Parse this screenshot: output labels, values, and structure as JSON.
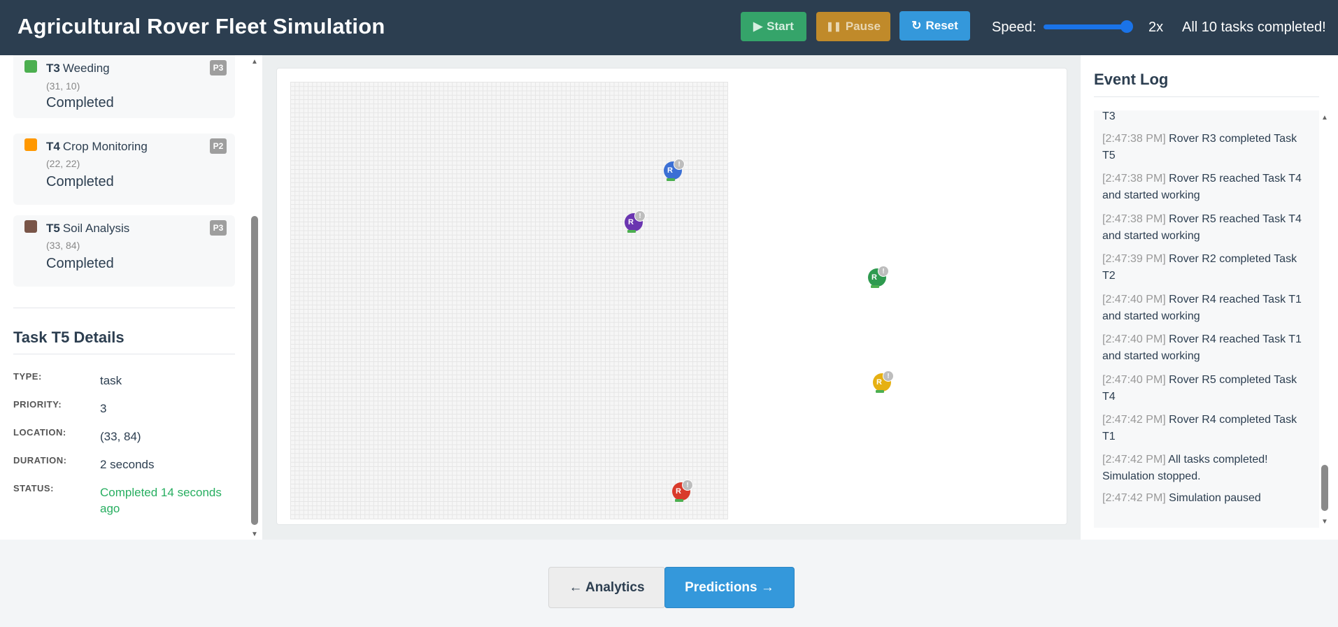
{
  "header": {
    "title": "Agricultural Rover Fleet Simulation",
    "start_label": "Start",
    "pause_label": "Pause",
    "reset_label": "Reset",
    "speed_label": "Speed:",
    "speed_value": "2x",
    "speed_slider_level": 1.0,
    "status": "All 10 tasks completed!"
  },
  "tasks": [
    {
      "id": "T3",
      "name": "Weeding",
      "coords": "(31, 10)",
      "status": "Completed",
      "priority": "P3",
      "color": "#4caf50"
    },
    {
      "id": "T4",
      "name": "Crop Monitoring",
      "coords": "(22, 22)",
      "status": "Completed",
      "priority": "P2",
      "color": "#ff9800"
    },
    {
      "id": "T5",
      "name": "Soil Analysis",
      "coords": "(33, 84)",
      "status": "Completed",
      "priority": "P3",
      "color": "#795548"
    }
  ],
  "details": {
    "title": "Task T5 Details",
    "rows": [
      {
        "label": "TYPE:",
        "value": "task"
      },
      {
        "label": "PRIORITY:",
        "value": "3"
      },
      {
        "label": "LOCATION:",
        "value": "(33, 84)"
      },
      {
        "label": "DURATION:",
        "value": "2 seconds"
      },
      {
        "label": "STATUS:",
        "value": "Completed 14 seconds ago"
      }
    ]
  },
  "rovers": [
    {
      "label": "R",
      "color": "#3b6fd4",
      "badge": "!"
    },
    {
      "label": "R",
      "color": "#6a35b0",
      "badge": "!"
    },
    {
      "label": "R",
      "color": "#2e9a4f",
      "badge": "!"
    },
    {
      "label": "R",
      "color": "#e6b012",
      "badge": "!"
    },
    {
      "label": "R",
      "color": "#d93a2b",
      "badge": "!"
    }
  ],
  "log": {
    "title": "Event Log",
    "entries": [
      {
        "time": "",
        "text": "T3"
      },
      {
        "time": "[2:47:38 PM]",
        "text": "Rover R3 completed Task T5"
      },
      {
        "time": "[2:47:38 PM]",
        "text": "Rover R5 reached Task T4 and started working"
      },
      {
        "time": "[2:47:38 PM]",
        "text": "Rover R5 reached Task T4 and started working"
      },
      {
        "time": "[2:47:39 PM]",
        "text": "Rover R2 completed Task T2"
      },
      {
        "time": "[2:47:40 PM]",
        "text": "Rover R4 reached Task T1 and started working"
      },
      {
        "time": "[2:47:40 PM]",
        "text": "Rover R4 reached Task T1 and started working"
      },
      {
        "time": "[2:47:40 PM]",
        "text": "Rover R5 completed Task T4"
      },
      {
        "time": "[2:47:42 PM]",
        "text": "Rover R4 completed Task T1"
      },
      {
        "time": "[2:47:42 PM]",
        "text": "All tasks completed! Simulation stopped."
      },
      {
        "time": "[2:47:42 PM]",
        "text": "Simulation paused"
      }
    ]
  },
  "nav": {
    "back_label": "← Analytics",
    "next_label": "Predictions →"
  }
}
